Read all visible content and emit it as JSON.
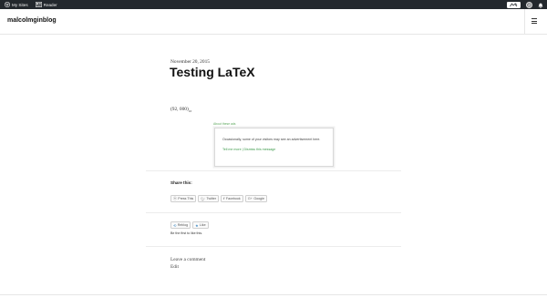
{
  "admin_bar": {
    "my_sites": "My Sites",
    "reader": "Reader",
    "icons": [
      "wordpress-logo-icon",
      "reader-icon",
      "write-post-icon",
      "user-avatar-icon",
      "notifications-bell-icon"
    ]
  },
  "site": {
    "title": "malcolmginblog"
  },
  "post": {
    "date": "November 20, 2015",
    "title": "Testing LaTeX",
    "latex_main": "(92, 000)",
    "latex_sub": "10"
  },
  "ad": {
    "about": "About these ads",
    "text": "Occasionally, some of your visitors may see an advertisement here.",
    "links": "Tell me more | Dismiss this message"
  },
  "share": {
    "title": "Share this:",
    "buttons": [
      "Press This",
      "Twitter",
      "Facebook",
      "Google"
    ]
  },
  "like": {
    "reblog": "Reblog",
    "like": "Like",
    "note": "Be the first to like this."
  },
  "comments": {
    "leave": "Leave a comment",
    "edit": "Edit"
  }
}
